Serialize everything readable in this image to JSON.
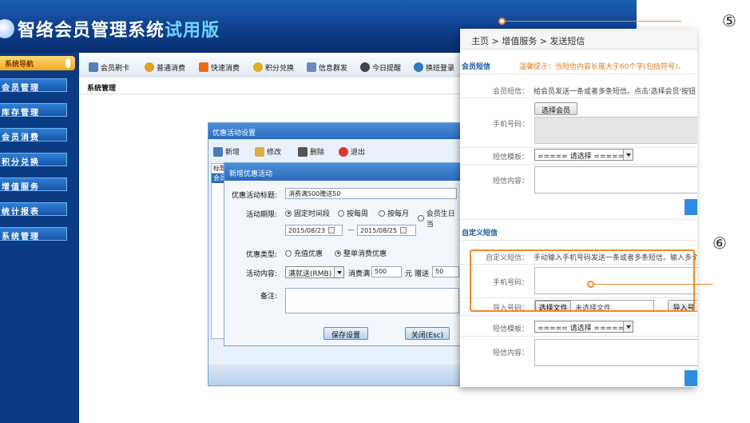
{
  "header": {
    "title": "智络会员管理系统",
    "title_badge": "试用版"
  },
  "sidebar": {
    "head_label": "系统导航",
    "items": [
      {
        "label": "会员管理"
      },
      {
        "label": "库存管理"
      },
      {
        "label": "会员消费"
      },
      {
        "label": "积分兑换"
      },
      {
        "label": "增值服务"
      },
      {
        "label": "统计报表"
      },
      {
        "label": "系统管理"
      }
    ]
  },
  "toolbar": {
    "items": [
      {
        "label": "会员刷卡",
        "icon": "card-icon",
        "color": "#5a7fb8"
      },
      {
        "label": "普通消费",
        "icon": "coin-icon",
        "color": "#e0a020"
      },
      {
        "label": "快速消费",
        "icon": "lightning-icon",
        "color": "#e86b1a"
      },
      {
        "label": "积分兑换",
        "icon": "gift-icon",
        "color": "#e0b020"
      },
      {
        "label": "信息群发",
        "icon": "mail-icon",
        "color": "#6a8ab8"
      },
      {
        "label": "今日提醒",
        "icon": "clock-icon",
        "color": "#444444"
      },
      {
        "label": "换班登录",
        "icon": "swap-icon",
        "color": "#2a78c8"
      }
    ]
  },
  "section_title": "系统管理",
  "promo_dialog": {
    "title": "优惠活动设置",
    "tools": [
      {
        "label": "新增",
        "icon": "add-icon"
      },
      {
        "label": "修改",
        "icon": "edit-icon"
      },
      {
        "label": "删除",
        "icon": "delete-icon"
      },
      {
        "label": "退出",
        "icon": "exit-icon"
      }
    ],
    "list_header": "标题",
    "list_row": "会员"
  },
  "new_dialog": {
    "title": "新增优惠活动",
    "activity_title_label": "优惠活动标题:",
    "activity_title_value": "消费满500赠送50",
    "period_label": "活动期限:",
    "period_options": [
      "固定时间段",
      "按每周",
      "按每月",
      "会员生日当"
    ],
    "date_from": "2015/08/23",
    "date_sep": "—",
    "date_to": "2015/08/25",
    "type_label": "优惠类型:",
    "type_options": [
      "充值优惠",
      "整单消费优惠"
    ],
    "content_label": "活动内容:",
    "content_select": "满就送(RMB)",
    "spend_label": "消费满",
    "spend_value": "500",
    "unit_label": "元",
    "gift_label": "赠送",
    "gift_value": "50",
    "remark_label": "备注:",
    "save_button": "保存设置",
    "close_button": "关闭(Esc)"
  },
  "sms_panel": {
    "breadcrumb": "主页  >  增值服务  >  发送短信",
    "member_section": "会员短信",
    "hint": "温馨提示：当短信内容长度大于60个字(包括符号)，",
    "member_sms_label": "会员短信：",
    "member_sms_desc": "给会员发送一条或者多条短信。点击'选择会员'按钮",
    "select_member_button": "选择会员",
    "phone_label": "手机号码：",
    "template_label": "短信模板：",
    "template_select": "===== 请选择 =====",
    "content_label": "短信内容：",
    "custom_section": "自定义短信",
    "custom_label": "自定义短信：",
    "custom_desc": "手动输入手机号码发送一条或者多条短信。输入多个",
    "phone_label_2": "手机号码：",
    "import_label": "导入号码：",
    "choose_file_button": "选择文件",
    "no_file_text": "未选择文件",
    "import_button": "导入号",
    "template_label_2": "短信模板：",
    "template_select_2": "===== 请选择 =====",
    "content_label_2": "短信内容："
  },
  "callouts": {
    "top": "⑤",
    "bottom": "⑥",
    "accent_color": "#f08a2b"
  }
}
